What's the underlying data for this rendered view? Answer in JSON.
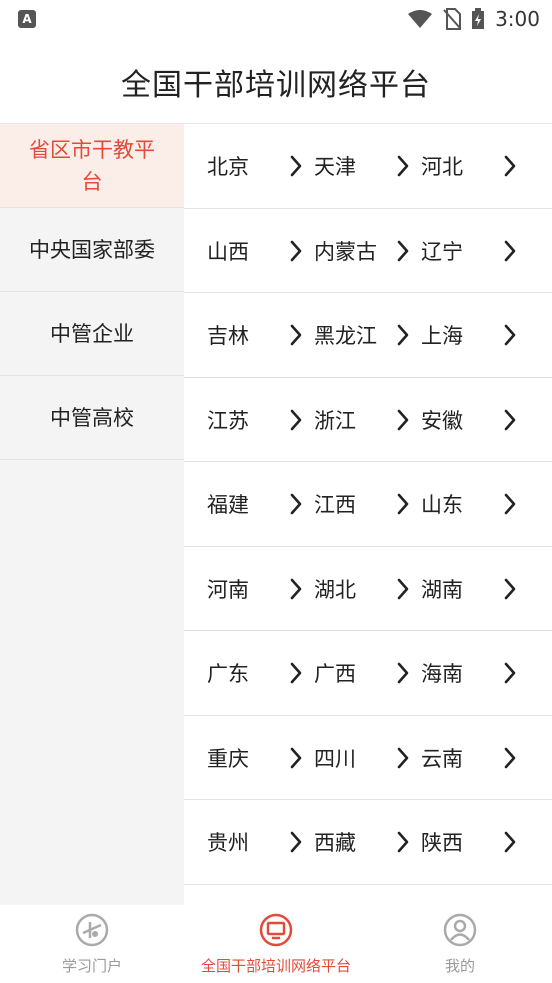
{
  "status_bar": {
    "time": "3:00",
    "left_icon_letter": "A",
    "icons": [
      "wifi-icon",
      "no-sim-icon",
      "battery-charging-icon"
    ]
  },
  "header": {
    "title": "全国干部培训网络平台"
  },
  "sidebar": {
    "items": [
      {
        "label": "省区市干教平台",
        "active": true
      },
      {
        "label": "中央国家部委",
        "active": false
      },
      {
        "label": "中管企业",
        "active": false
      },
      {
        "label": "中管高校",
        "active": false
      }
    ]
  },
  "grid": {
    "rows": [
      [
        "北京",
        "天津",
        "河北"
      ],
      [
        "山西",
        "内蒙古",
        "辽宁"
      ],
      [
        "吉林",
        "黑龙江",
        "上海"
      ],
      [
        "江苏",
        "浙江",
        "安徽"
      ],
      [
        "福建",
        "江西",
        "山东"
      ],
      [
        "河南",
        "湖北",
        "湖南"
      ],
      [
        "广东",
        "广西",
        "海南"
      ],
      [
        "重庆",
        "四川",
        "云南"
      ],
      [
        "贵州",
        "西藏",
        "陕西"
      ]
    ],
    "chevron_icon": "chevron-right-icon"
  },
  "bottom_nav": {
    "items": [
      {
        "label": "学习门户",
        "icon": "portal-icon",
        "active": false
      },
      {
        "label": "全国干部培训网络平台",
        "icon": "monitor-icon",
        "active": true
      },
      {
        "label": "我的",
        "icon": "user-icon",
        "active": false
      }
    ]
  },
  "colors": {
    "accent": "#e24a3a",
    "sidebar_bg": "#f4f4f4",
    "active_sidebar_bg": "#fbeee8",
    "inactive_nav": "#999999"
  }
}
